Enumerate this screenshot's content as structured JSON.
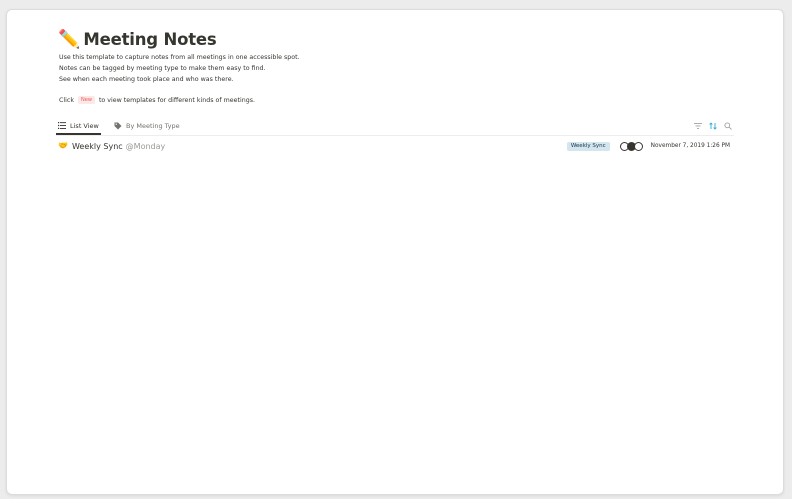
{
  "page": {
    "title_emoji": "✏️",
    "title": "Meeting Notes",
    "description": [
      "Use this template to capture notes from all meetings in one accessible spot.",
      "Notes can be tagged by meeting type to make them easy to find.",
      "See when each meeting took place and who was there."
    ],
    "click_prefix": "Click",
    "new_badge": "New",
    "click_suffix": "to view templates for different kinds of meetings."
  },
  "tabs": [
    {
      "label": "List View",
      "icon": "list-icon",
      "active": true
    },
    {
      "label": "By Meeting Type",
      "icon": "tag-icon",
      "active": false
    }
  ],
  "toolbar": {
    "icons": [
      "filter-icon",
      "sort-icon",
      "search-icon"
    ],
    "accent": "#2eaadc"
  },
  "rows": [
    {
      "emoji": "🤝",
      "title": "Weekly Sync",
      "mention": "@Monday",
      "tag": "Weekly Sync",
      "tag_color": "#d3e5ef",
      "date": "November 7, 2019 1:26 PM"
    }
  ]
}
